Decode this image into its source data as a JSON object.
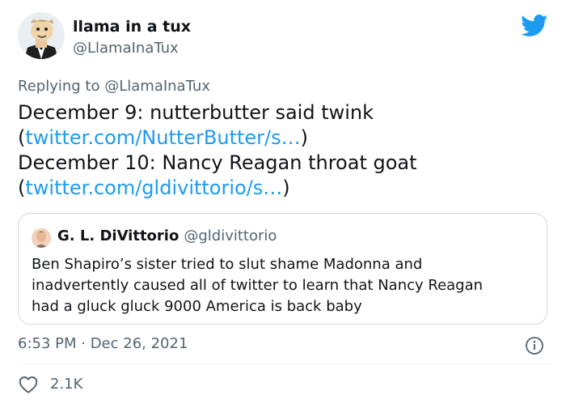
{
  "author": {
    "display_name": "llama in a tux",
    "handle": "@LlamaInaTux"
  },
  "icons": {
    "brand": "twitter-bird-icon",
    "info": "info-icon",
    "like": "heart-icon"
  },
  "colors": {
    "link": "#1d9bf0",
    "secondary_text": "#536471",
    "brand_blue": "#1d9bf0"
  },
  "reply": {
    "prefix": "Replying to",
    "mention": "@LlamaInaTux"
  },
  "body": {
    "line1": "December 9: nutterbutter said twink",
    "link1_open": "(",
    "link1": "twitter.com/NutterButter/s…",
    "link1_close": ")",
    "line2": "December 10: Nancy Reagan throat goat",
    "link2_open": "(",
    "link2": "twitter.com/gldivittorio/s…",
    "link2_close": ")"
  },
  "quote": {
    "name": "G. L. DiVittorio",
    "handle": "@gldivittorio",
    "text_line1": "Ben Shapiro’s sister tried to slut shame Madonna and",
    "text_line2": "inadvertently caused all of twitter to learn that Nancy Reagan",
    "text_line3": "had a gluck gluck 9000 America is back baby"
  },
  "meta": {
    "timestamp": "6:53 PM · Dec 26, 2021"
  },
  "engagement": {
    "likes": "2.1K"
  }
}
